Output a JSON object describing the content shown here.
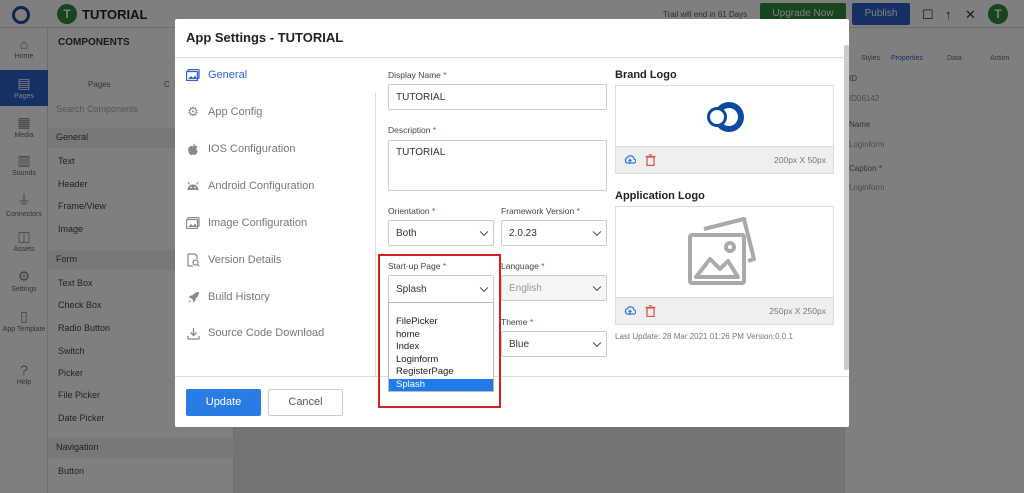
{
  "app": {
    "name": "TUTORIAL",
    "avatar": "T",
    "trial_text": "Trail will end in 61 Days",
    "upgrade_label": "Upgrade Now",
    "publish_label": "Publish",
    "user_avatar": "T"
  },
  "left_rail": {
    "items": [
      "Home",
      "Pages",
      "Media",
      "Sounds",
      "Connectors",
      "Assets",
      "Settings",
      "App Template",
      "Help"
    ]
  },
  "components": {
    "title": "COMPONENTS",
    "tabs": [
      "Pages",
      "C"
    ],
    "search_placeholder": "Search Components",
    "general_label": "General",
    "general_items": [
      "Text",
      "Header",
      "Frame/View",
      "Image"
    ],
    "form_label": "Form",
    "form_items": [
      "Text Box",
      "Check Box",
      "Radio Button",
      "Switch",
      "Picker",
      "File Picker",
      "Date Picker"
    ],
    "navigation_label": "Navigation",
    "navigation_items": [
      "Button"
    ]
  },
  "right_panel": {
    "tabs": [
      "Styles",
      "Properties",
      "Data",
      "Action"
    ],
    "fields": [
      "ID",
      "ID06142",
      "Name",
      "Loginform",
      "Caption *",
      "Loginform"
    ]
  },
  "modal": {
    "title": "App Settings - TUTORIAL",
    "nav": [
      {
        "label": "General",
        "icon": "image-icon",
        "active": true
      },
      {
        "label": "App Config",
        "icon": "gears-icon"
      },
      {
        "label": "IOS Configuration",
        "icon": "apple-icon"
      },
      {
        "label": "Android Configuration",
        "icon": "android-icon"
      },
      {
        "label": "Image Configuration",
        "icon": "images-icon"
      },
      {
        "label": "Version Details",
        "icon": "search-doc-icon"
      },
      {
        "label": "Build History",
        "icon": "rocket-icon"
      },
      {
        "label": "Source Code Download",
        "icon": "download-icon"
      }
    ],
    "display_name": {
      "label": "Display Name",
      "value": "TUTORIAL"
    },
    "description": {
      "label": "Description",
      "value": "TUTORIAL"
    },
    "orientation": {
      "label": "Orientation",
      "value": "Both"
    },
    "framework_version": {
      "label": "Framework Version",
      "value": "2.0.23"
    },
    "startup_page": {
      "label": "Start-up Page",
      "value": "Splash",
      "options": [
        "FilePicker",
        "home",
        "Index",
        "Loginform",
        "RegisterPage",
        "Splash"
      ],
      "selected": "Splash"
    },
    "language": {
      "label": "Language",
      "value": "English"
    },
    "theme": {
      "label": "Theme",
      "value": "Blue"
    },
    "brand_logo": {
      "label": "Brand Logo",
      "dimensions": "200px X 50px"
    },
    "application_logo": {
      "label": "Application Logo",
      "dimensions": "250px X 250px"
    },
    "last_update": "Last Update: 28 Mar 2021 01:26 PM Version:0.0.1",
    "update_label": "Update",
    "cancel_label": "Cancel",
    "required_mark": "*"
  },
  "colors": {
    "accent": "#2a7be4",
    "highlight": "#d32020",
    "brand_green": "#2e8b3d"
  }
}
